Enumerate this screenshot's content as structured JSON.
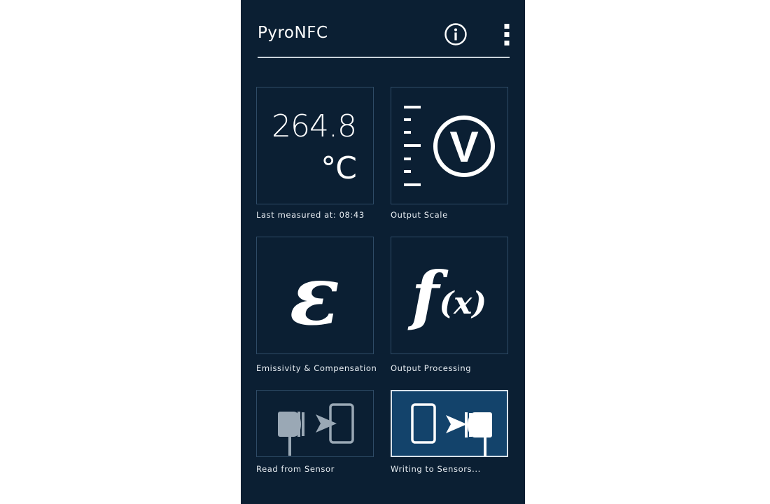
{
  "header": {
    "title": "PyroNFC",
    "info_icon": "info-circle-icon",
    "menu_icon": "more-vert-icon"
  },
  "tiles": {
    "temperature": {
      "value": "264.8",
      "unit": "°C",
      "label": "Last measured at: 08:43"
    },
    "output_scale": {
      "glyph": "V",
      "label": "Output Scale",
      "icon": "voltage-scale-icon"
    },
    "emissivity": {
      "glyph": "ε",
      "label": "Emissivity & Compensation",
      "icon": "epsilon-icon"
    },
    "output_processing": {
      "glyph_f": "f",
      "glyph_x": "(x)",
      "label": "Output Processing",
      "icon": "function-icon"
    },
    "read_sensor": {
      "label": "Read from Sensor",
      "icon": "sensor-to-phone-icon"
    },
    "write_sensors": {
      "label": "Writing to Sensors...",
      "icon": "phone-to-sensor-icon"
    }
  },
  "colors": {
    "background": "#0b1f33",
    "tile_border": "#2e4b66",
    "active_tile": "#13436b",
    "text": "#ffffff",
    "muted_icon": "#9aa8b5"
  }
}
